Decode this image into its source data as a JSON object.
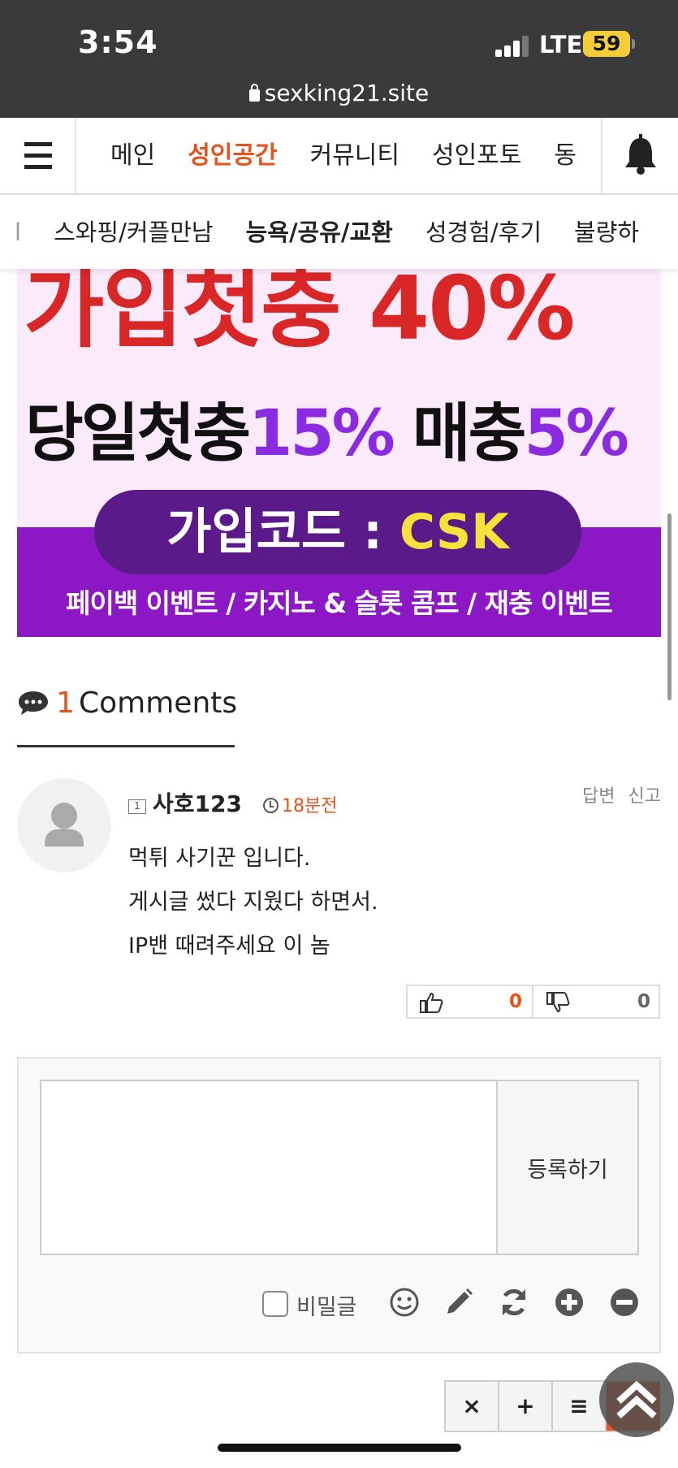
{
  "status_bar": {
    "time": "3:54",
    "network": "LTE",
    "battery": "59",
    "url": "sexking21.site"
  },
  "nav": {
    "menu": [
      {
        "label": "메인",
        "active": false
      },
      {
        "label": "성인공간",
        "active": true
      },
      {
        "label": "커뮤니티",
        "active": false
      },
      {
        "label": "성인포토",
        "active": false
      },
      {
        "label": "동",
        "active": false
      }
    ],
    "sub_menu": [
      {
        "label": "l",
        "bold": false
      },
      {
        "label": "스와핑/커플만남",
        "bold": false
      },
      {
        "label": "능욕/공유/교환",
        "bold": true
      },
      {
        "label": "성경험/후기",
        "bold": false
      },
      {
        "label": "불량하",
        "bold": false
      }
    ]
  },
  "banner": {
    "line1": "가입첫충 40%",
    "line2_a": "당일첫충",
    "line2_b": "15%",
    "line2_c": " 매충",
    "line2_d": "5%",
    "code_label": "가입코드 : ",
    "code": "CSK",
    "events": "페이백 이벤트 / 카지노 & 슬롯 콤프 / 재충 이벤트"
  },
  "comments": {
    "count": "1",
    "label": "Comments",
    "items": [
      {
        "level": "1",
        "author": "사호123",
        "time": "18분전",
        "reply": "답변",
        "report": "신고",
        "lines": [
          "먹튀 사기꾼 입니다.",
          "게시글 썼다 지웠다 하면서.",
          "IP밴 때려주세요 이 놈"
        ],
        "likes": "0",
        "dislikes": "0"
      }
    ]
  },
  "form": {
    "submit_label": "등록하기",
    "secret_label": "비밀글"
  },
  "float_bar": {
    "close": "×",
    "add": "+",
    "list": "≡"
  },
  "colors": {
    "accent": "#e8521c",
    "statusbar": "#3a3a3c",
    "banner_purple": "#8b18c4"
  }
}
